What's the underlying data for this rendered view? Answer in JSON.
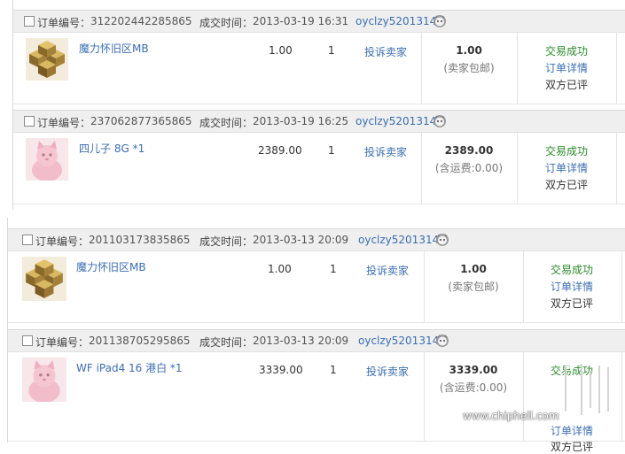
{
  "labels": {
    "order_no": "订单编号：",
    "deal_time": "成交时间：",
    "complain": "投诉卖家",
    "status": "交易成功",
    "details": "订单详情",
    "rated": "双方已评"
  },
  "orders": [
    {
      "order_id": "312202442285865",
      "time": "2013-03-19 16:31",
      "seller": "oyclzy5201314",
      "item": "魔力怀旧区MB",
      "thumb": "gold-blocks-thumbnail",
      "price": "1.00",
      "qty": "1",
      "total": "1.00",
      "shipping": "(卖家包邮)"
    },
    {
      "order_id": "237062877365865",
      "time": "2013-03-19 16:25",
      "seller": "oyclzy5201314",
      "item": "四儿子 8G *1",
      "thumb": "pink-cat-thumbnail",
      "price": "2389.00",
      "qty": "1",
      "total": "2389.00",
      "shipping": "(含运费:0.00)"
    },
    {
      "order_id": "201103173835865",
      "time": "2013-03-13 20:09",
      "seller": "oyclzy5201314",
      "item": "魔力怀旧区MB",
      "thumb": "gold-blocks-thumbnail",
      "price": "1.00",
      "qty": "1",
      "total": "1.00",
      "shipping": "(卖家包邮)"
    },
    {
      "order_id": "201138705295865",
      "time": "2013-03-13 20:09",
      "seller": "oyclzy5201314",
      "item": "WF iPad4 16 港白 *1",
      "thumb": "pink-cat-thumbnail",
      "price": "3339.00",
      "qty": "1",
      "total": "3339.00",
      "shipping": "(含运费:0.00)"
    }
  ],
  "watermark": {
    "url": "www.chiphell.com"
  },
  "colors": {
    "link": "#3b6eb0",
    "success": "#2a8a2a",
    "header_bg": "#efefef"
  },
  "icons": {
    "seller_chat": "aliwangwang-icon",
    "checkbox": "checkbox-icon"
  }
}
